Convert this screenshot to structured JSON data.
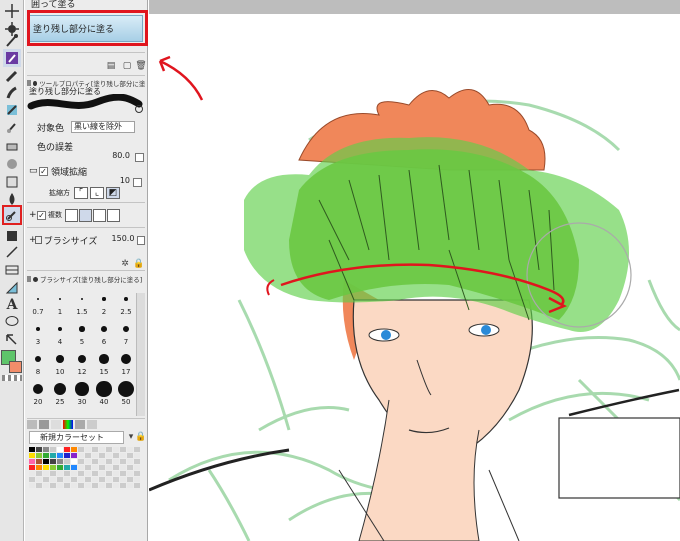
{
  "subtools": {
    "item_above": "囲って塗る",
    "selected": "塗り残し部分に塗る"
  },
  "tool_property": {
    "header": "ツールプロパティ[塗り残し部分に塗る]",
    "subtool_name": "塗り残し部分に塗る",
    "target_color_label": "対象色",
    "target_color_value": "黒い線を除外",
    "color_margin_label": "色の誤差",
    "color_margin_value": "80.0",
    "area_scaling_label": "領域拡縮",
    "area_scaling_value": "10",
    "scaling_method_label": "拡縮方",
    "multi_ref_label": "複数",
    "brush_size_label": "ブラシサイズ",
    "brush_size_value": "150.0"
  },
  "brush_size_panel": {
    "header": "ブラシサイズ[塗り残し部分に塗る]",
    "sizes": [
      "0.7",
      "1",
      "1.5",
      "2",
      "2.5",
      "3",
      "4",
      "5",
      "6",
      "7",
      "8",
      "10",
      "12",
      "15",
      "17",
      "20",
      "25",
      "30",
      "40",
      "50"
    ]
  },
  "color_set": {
    "name": "新規カラーセット"
  },
  "colors": {
    "main_color": "#5ec46a",
    "sub_color": "#f28d6a",
    "highlight_red": "#e0151e",
    "fill_green": "#5fd04a",
    "hair_orange": "#f0875a",
    "sketch_green": "#9fd7a6"
  },
  "toolbar_icons": [
    "move-icon",
    "rotate-icon",
    "eyedropper-icon",
    "pen-icon",
    "pencil-icon",
    "brush-icon",
    "airbrush-icon",
    "decoration-icon",
    "eraser-icon",
    "blend-icon",
    "fill-icon",
    "gradient-icon",
    "figure-icon",
    "line-icon",
    "frame-icon",
    "ruler-icon",
    "text-icon",
    "balloon-icon",
    "correct-line-icon"
  ]
}
